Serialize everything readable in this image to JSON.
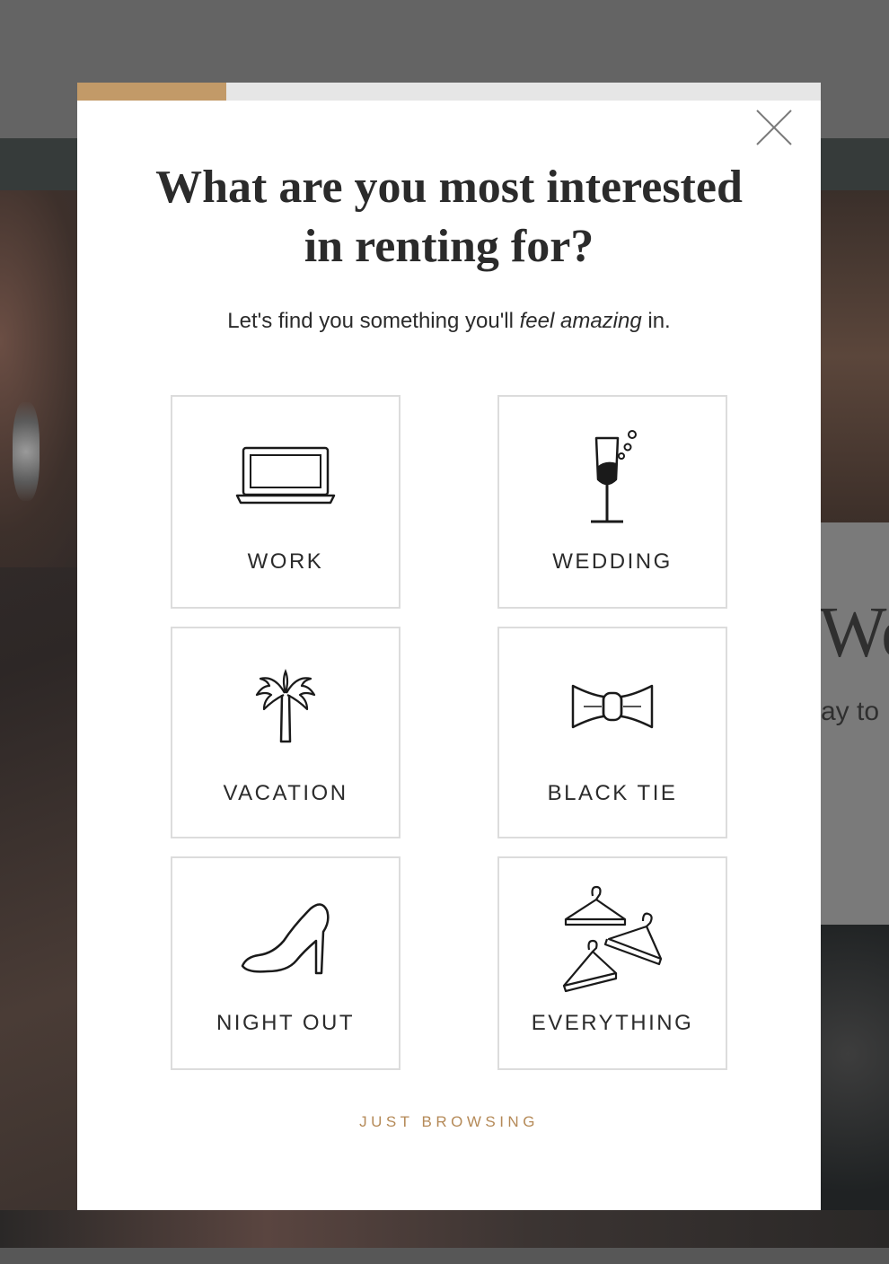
{
  "background": {
    "card_title_partial": "We",
    "card_text_partial": "ay to"
  },
  "modal": {
    "progress": 0.2,
    "progress_color": "#c29a68",
    "close_icon": "close-icon",
    "title": "What are you most interested in renting for?",
    "subtitle_before": "Let's find you something you'll ",
    "subtitle_emphasis": "feel amazing",
    "subtitle_after": " in.",
    "options": [
      {
        "label": "WORK",
        "icon": "laptop-icon"
      },
      {
        "label": "WEDDING",
        "icon": "champagne-glass-icon"
      },
      {
        "label": "VACATION",
        "icon": "palm-tree-icon"
      },
      {
        "label": "BLACK TIE",
        "icon": "bow-tie-icon"
      },
      {
        "label": "NIGHT OUT",
        "icon": "high-heel-icon"
      },
      {
        "label": "EVERYTHING",
        "icon": "hangers-icon"
      }
    ],
    "just_browsing": "JUST BROWSING",
    "accent_color": "#b58a58"
  }
}
